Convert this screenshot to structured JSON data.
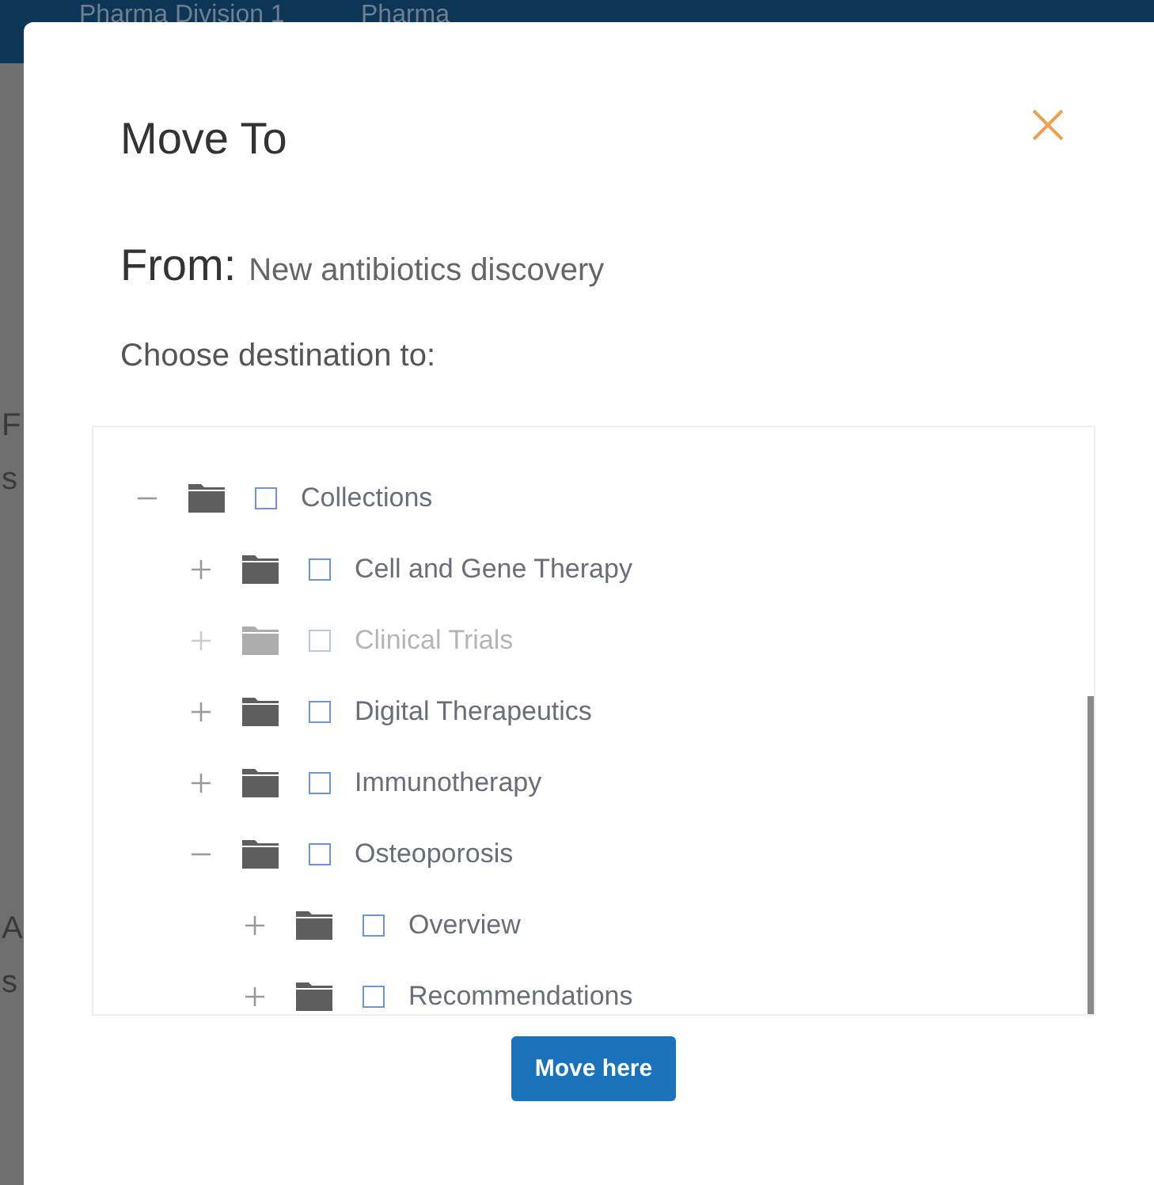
{
  "background": {
    "header_texts": [
      "Pharma Division 1",
      "Pharma"
    ],
    "side_texts": [
      "F",
      "s",
      "A",
      "s"
    ]
  },
  "dialog": {
    "title": "Move To",
    "from_label": "From:",
    "from_value": "New antibiotics discovery",
    "prompt": "Choose destination to:",
    "tree": [
      {
        "label": "Collections",
        "expanded": true,
        "checked": false,
        "disabled": false,
        "children": [
          {
            "label": "Cell and Gene Therapy",
            "expanded": false,
            "checked": false,
            "disabled": false
          },
          {
            "label": "Clinical Trials",
            "expanded": false,
            "checked": false,
            "disabled": true
          },
          {
            "label": "Digital Therapeutics",
            "expanded": false,
            "checked": false,
            "disabled": false
          },
          {
            "label": "Immunotherapy",
            "expanded": false,
            "checked": false,
            "disabled": false
          },
          {
            "label": "Osteoporosis",
            "expanded": true,
            "checked": false,
            "disabled": false,
            "children": [
              {
                "label": "Overview",
                "expanded": false,
                "checked": false,
                "disabled": false
              },
              {
                "label": "Recommendations",
                "expanded": false,
                "checked": false,
                "disabled": false
              }
            ]
          }
        ]
      }
    ],
    "button": "Move here"
  }
}
